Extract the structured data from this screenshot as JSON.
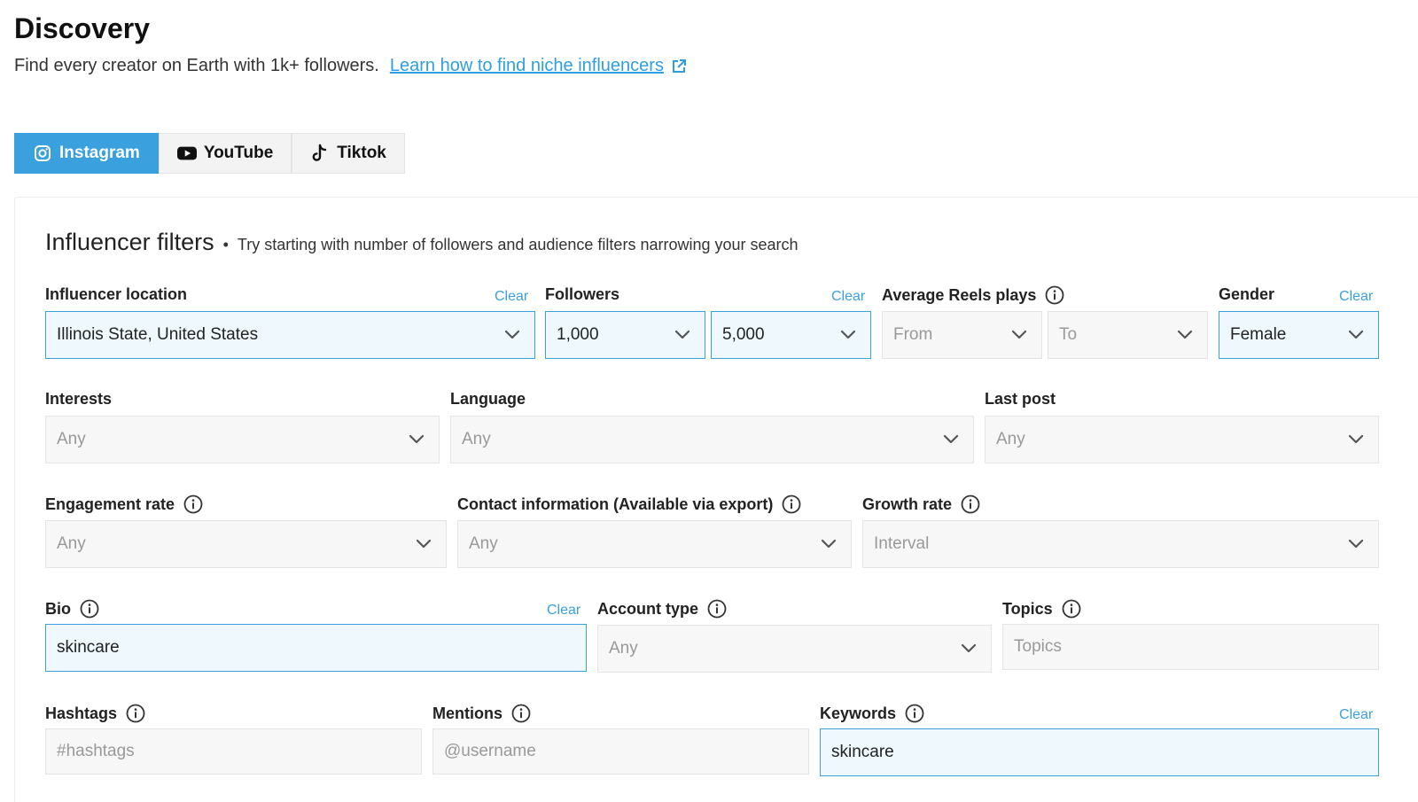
{
  "header": {
    "title": "Discovery",
    "subtitle": "Find every creator on Earth with 1k+ followers.",
    "link": "Learn how to find niche influencers"
  },
  "tabs": [
    {
      "label": "Instagram",
      "icon": "instagram-icon",
      "active": true
    },
    {
      "label": "YouTube",
      "icon": "youtube-icon",
      "active": false
    },
    {
      "label": "Tiktok",
      "icon": "tiktok-icon",
      "active": false
    }
  ],
  "filters": {
    "title": "Influencer filters",
    "hint": "Try starting with number of followers and audience filters narrowing your search",
    "clear_label": "Clear",
    "influencer_location": {
      "label": "Influencer location",
      "value": "Illinois State, United States"
    },
    "followers": {
      "label": "Followers",
      "from": "1,000",
      "to": "5,000"
    },
    "avg_reels_plays": {
      "label": "Average Reels plays",
      "from": "From",
      "to": "To"
    },
    "gender": {
      "label": "Gender",
      "value": "Female"
    },
    "interests": {
      "label": "Interests",
      "value": "Any"
    },
    "language": {
      "label": "Language",
      "value": "Any"
    },
    "last_post": {
      "label": "Last post",
      "value": "Any"
    },
    "engagement_rate": {
      "label": "Engagement rate",
      "value": "Any"
    },
    "contact_info": {
      "label": "Contact information (Available via export)",
      "value": "Any"
    },
    "growth_rate": {
      "label": "Growth rate",
      "value": "Interval"
    },
    "bio": {
      "label": "Bio",
      "value": "skincare"
    },
    "account_type": {
      "label": "Account type",
      "value": "Any"
    },
    "topics": {
      "label": "Topics",
      "placeholder": "Topics"
    },
    "hashtags": {
      "label": "Hashtags",
      "placeholder": "#hashtags"
    },
    "mentions": {
      "label": "Mentions",
      "placeholder": "@username"
    },
    "keywords": {
      "label": "Keywords",
      "value": "skincare"
    }
  },
  "colors": {
    "accent": "#3aa0de",
    "link": "#2f9ee0",
    "active_bg": "#eef8fd",
    "field_bg": "#f7f7f7"
  }
}
